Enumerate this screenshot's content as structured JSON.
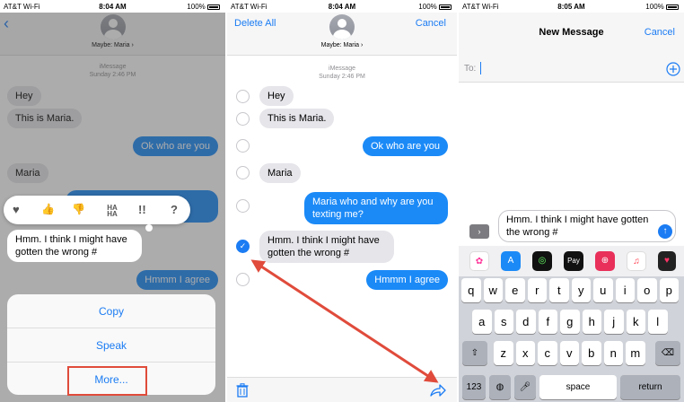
{
  "status": {
    "carrier": "AT&T Wi-Fi",
    "times": [
      "8:04 AM",
      "8:04 AM",
      "8:05 AM"
    ],
    "battery": "100%"
  },
  "contact": "Maybe: Maria ›",
  "thread": {
    "service": "iMessage",
    "timestamp": "Sunday 2:46 PM"
  },
  "panel1": {
    "tapbacks": [
      "♥",
      "👍",
      "👎",
      "HA HA",
      "!!",
      "?"
    ],
    "actions": [
      "Copy",
      "Speak",
      "More..."
    ]
  },
  "panel2": {
    "delete_all": "Delete All",
    "cancel": "Cancel"
  },
  "messages": [
    {
      "text": "Hey",
      "dir": "in"
    },
    {
      "text": "This is Maria.",
      "dir": "in"
    },
    {
      "text": "Ok who are you",
      "dir": "out"
    },
    {
      "text": "Maria",
      "dir": "in"
    },
    {
      "text": "Maria who and why are you texting me?",
      "dir": "out"
    },
    {
      "text": "Hmm. I think I might have gotten the wrong #",
      "dir": "in"
    },
    {
      "text": "Hmmm I agree",
      "dir": "out"
    }
  ],
  "panel3": {
    "title": "New Message",
    "cancel": "Cancel",
    "to_label": "To:",
    "draft": "Hmm. I think I might have gotten the wrong #",
    "app_icons": [
      "photos-app",
      "app-store",
      "activity",
      "apple-pay",
      "image-search",
      "music",
      "hearts"
    ],
    "keyboard": {
      "row1": [
        "q",
        "w",
        "e",
        "r",
        "t",
        "y",
        "u",
        "i",
        "o",
        "p"
      ],
      "row2": [
        "a",
        "s",
        "d",
        "f",
        "g",
        "h",
        "j",
        "k",
        "l"
      ],
      "row3": [
        "z",
        "x",
        "c",
        "v",
        "b",
        "n",
        "m"
      ],
      "numbers": "123",
      "space": "space",
      "return": "return"
    }
  },
  "colors": {
    "accent": "#1b7cf3",
    "sent_bubble": "#1b8af7",
    "highlight": "#e04b3b"
  }
}
